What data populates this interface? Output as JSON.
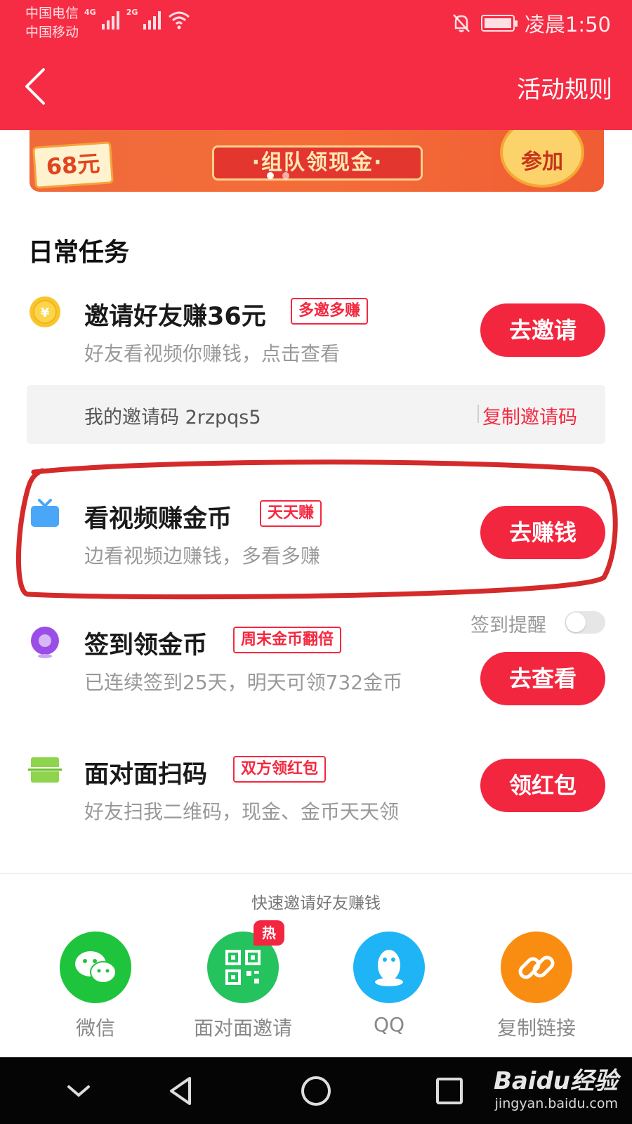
{
  "status_bar": {
    "carrier_1": "中国电信",
    "carrier_2": "中国移动",
    "net_1": "4G",
    "net_2": "2G",
    "time": "凌晨1:50"
  },
  "header": {
    "rules_label": "活动规则",
    "color": "#f52c44"
  },
  "banner": {
    "amount": "68元",
    "center_text": "·组队领现金·",
    "join_text": "参加"
  },
  "section": {
    "title": "日常任务"
  },
  "tasks": [
    {
      "icon": "coin-icon",
      "title": "邀请好友赚36元",
      "tag": "多邀多赚",
      "desc": "好友看视频你赚钱，点击查看",
      "button": "去邀请"
    },
    {
      "icon": "tv-icon",
      "title": "看视频赚金币",
      "tag": "天天赚",
      "desc": "边看视频边赚钱，多看多赚",
      "button": "去赚钱"
    },
    {
      "icon": "location-icon",
      "title": "签到领金币",
      "tag": "周末金币翻倍",
      "desc": "已连续签到25天，明天可领732金币",
      "button": "去查看"
    },
    {
      "icon": "scan-icon",
      "title": "面对面扫码",
      "tag": "双方领红包",
      "desc": "好友扫我二维码，现金、金币天天领",
      "button": "领红包"
    }
  ],
  "invite_code": {
    "text": "我的邀请码 2rzpqs5",
    "copy_label": "复制邀请码"
  },
  "reminder": {
    "label": "签到提醒",
    "enabled": false
  },
  "share": {
    "title": "快速邀请好友赚钱",
    "items": [
      {
        "icon": "wechat-icon",
        "label": "微信",
        "color": "#1ec43b"
      },
      {
        "icon": "qrcode-icon",
        "label": "面对面邀请",
        "color": "#24c35e",
        "badge": "热"
      },
      {
        "icon": "qq-icon",
        "label": "QQ",
        "color": "#1fb4f5"
      },
      {
        "icon": "link-icon",
        "label": "复制链接",
        "color": "#f98d12"
      }
    ]
  },
  "watermark": {
    "logo": "Baidu经验",
    "url": "jingyan.baidu.com"
  },
  "colors": {
    "accent_red": "#f3263f",
    "annotation": "#d42a2a"
  }
}
